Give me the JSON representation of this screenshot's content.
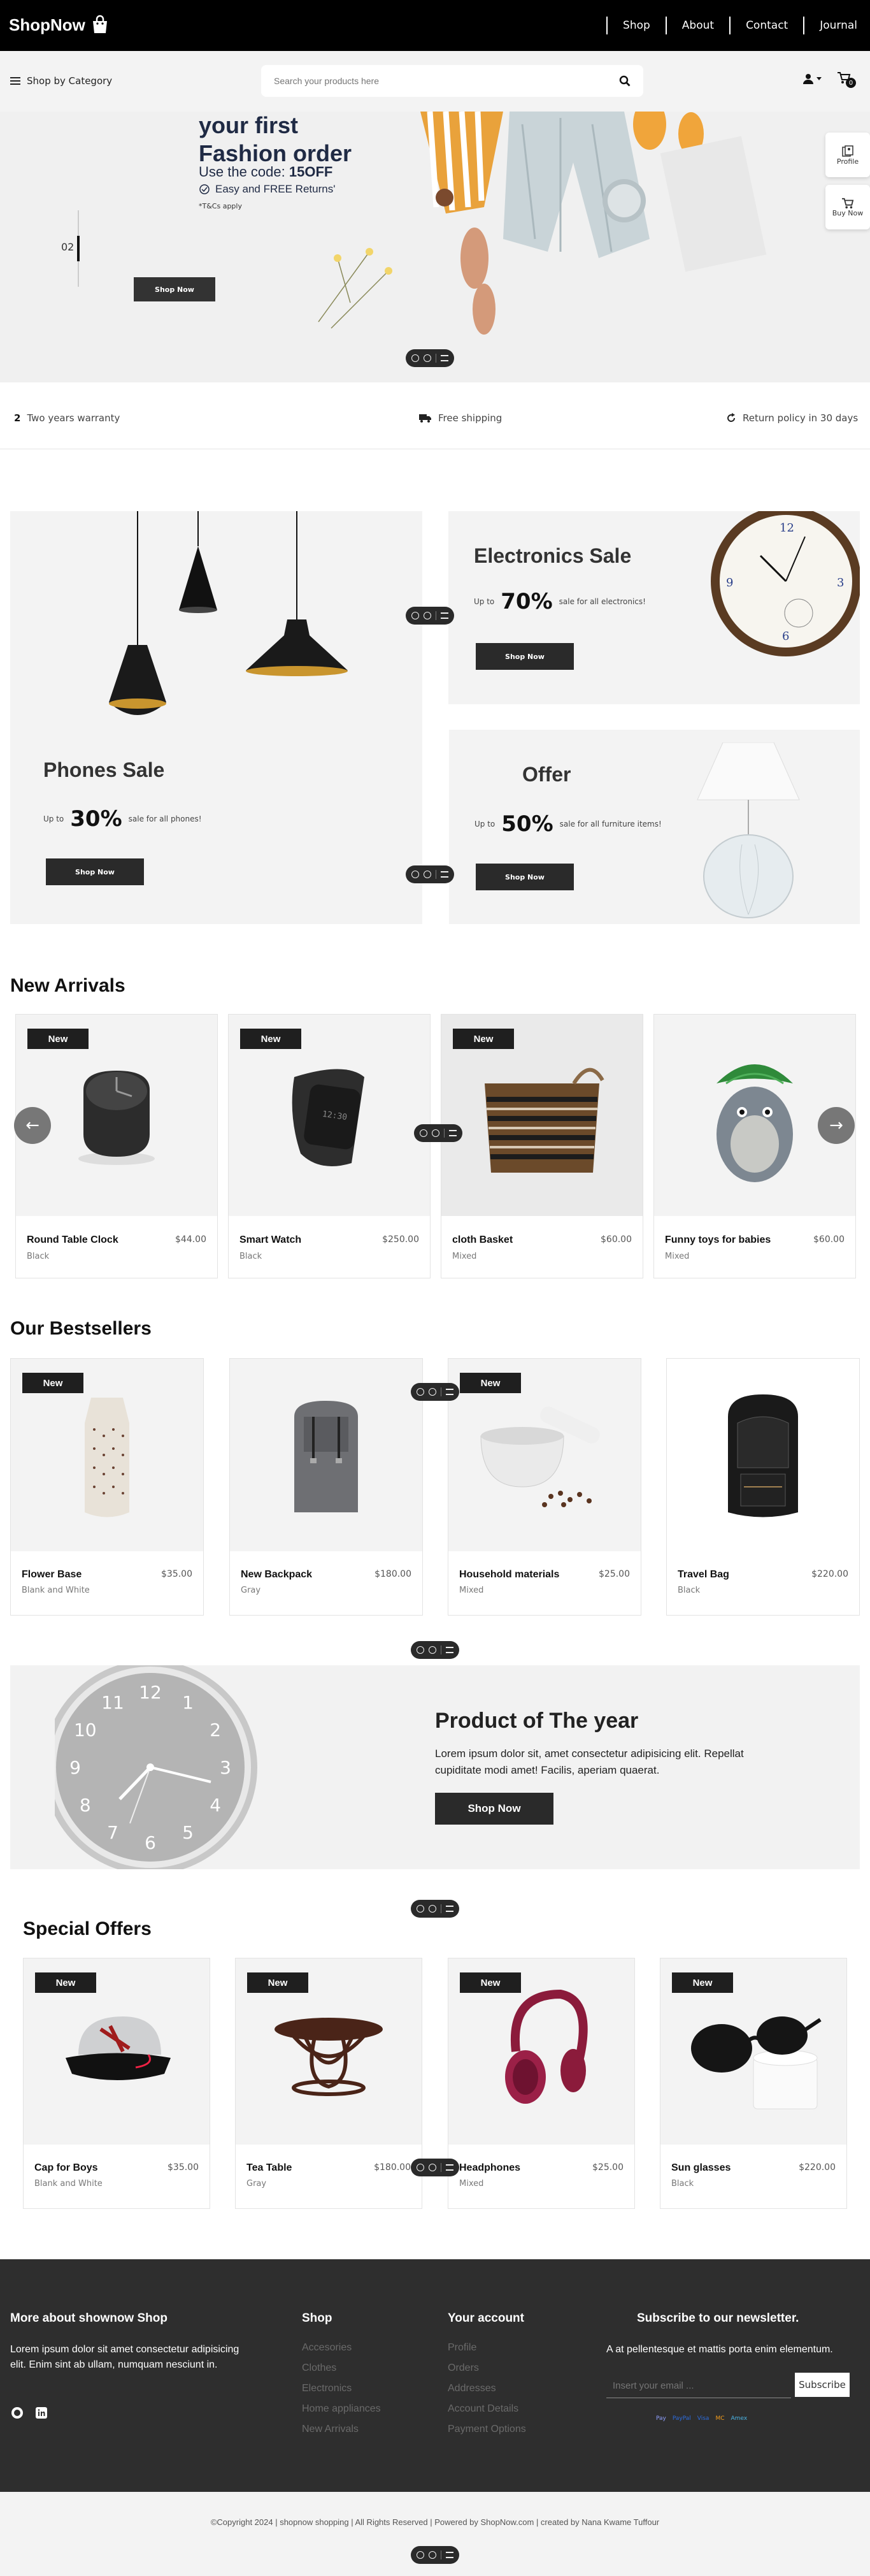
{
  "brand": {
    "name": "ShopNow"
  },
  "nav": {
    "items": [
      "Shop",
      "About",
      "Contact",
      "Journal"
    ]
  },
  "subbar": {
    "category_label": "Shop by Category",
    "search_placeholder": "Search your products here",
    "cart_count": "0"
  },
  "hero": {
    "title_line1": "your first",
    "title_line2": "Fashion order",
    "code_prefix": "Use the code: ",
    "code": "15OFF",
    "returns": "Easy and FREE Returns'",
    "tcs": "*T&Cs apply",
    "slide_number": "02",
    "button": "Shop Now"
  },
  "side_buttons": {
    "profile": "Profile",
    "buy_now": "Buy Now"
  },
  "features": {
    "warranty_num": "2",
    "warranty": "Two years warranty",
    "shipping": "Free shipping",
    "return_policy": "Return policy in 30 days"
  },
  "promos": {
    "phones": {
      "title": "Phones Sale",
      "upto": "Up to",
      "percent": "30%",
      "desc": "sale for all phones!",
      "button": "Shop Now"
    },
    "electronics": {
      "title": "Electronics Sale",
      "upto": "Up to",
      "percent": "70%",
      "desc": "sale for all electronics!",
      "button": "Shop Now"
    },
    "offer": {
      "title": "Offer",
      "upto": "Up to",
      "percent": "50%",
      "desc": "sale for all furniture items!",
      "button": "Shop Now"
    }
  },
  "new_arrivals": {
    "title": "New Arrivals",
    "badge": "New",
    "products": [
      {
        "name": "Round Table Clock",
        "price": "$44.00",
        "color": "Black"
      },
      {
        "name": "Smart Watch",
        "price": "$250.00",
        "color": "Black"
      },
      {
        "name": "cloth Basket",
        "price": "$60.00",
        "color": "Mixed"
      },
      {
        "name": "Funny toys for babies",
        "price": "$60.00",
        "color": "Mixed"
      }
    ],
    "prev_arrow": "←",
    "next_arrow": "→"
  },
  "bestsellers": {
    "title": "Our Bestsellers",
    "badge": "New",
    "products": [
      {
        "name": "Flower Base",
        "price": "$35.00",
        "color": "Blank and White"
      },
      {
        "name": "New Backpack",
        "price": "$180.00",
        "color": "Gray"
      },
      {
        "name": "Household materials",
        "price": "$25.00",
        "color": "Mixed"
      },
      {
        "name": "Travel Bag",
        "price": "$220.00",
        "color": "Black"
      }
    ]
  },
  "product_of_year": {
    "title": "Product of The year",
    "text": "Lorem ipsum dolor sit, amet consectetur adipisicing elit. Repellat cupiditate modi amet! Facilis, aperiam quaerat.",
    "button": "Shop Now",
    "clock_numbers": [
      "12",
      "1",
      "2",
      "3",
      "4",
      "5",
      "6",
      "7",
      "8",
      "9",
      "10",
      "11"
    ]
  },
  "special_offers": {
    "title": "Special Offers",
    "badge": "New",
    "products": [
      {
        "name": "Cap for Boys",
        "price": "$35.00",
        "color": "Blank and White"
      },
      {
        "name": "Tea Table",
        "price": "$180.00",
        "color": "Gray"
      },
      {
        "name": "Headphones",
        "price": "$25.00",
        "color": "Mixed"
      },
      {
        "name": "Sun glasses",
        "price": "$220.00",
        "color": "Black"
      }
    ]
  },
  "footer": {
    "about_title": "More about shownow Shop",
    "about_text": "Lorem ipsum dolor sit amet consectetur adipisicing elit. Enim sint ab ullam, numquam nesciunt in.",
    "shop_title": "Shop",
    "shop_links": [
      "Accesories",
      "Clothes",
      "Electronics",
      "Home appliances",
      "New Arrivals"
    ],
    "account_title": "Your account",
    "account_links": [
      "Profile",
      "Orders",
      "Addresses",
      "Account Details",
      "Payment Options"
    ],
    "newsletter_title": "Subscribe to our newsletter.",
    "newsletter_text": "A at pellentesque et mattis porta enim elementum.",
    "email_placeholder": "Insert your email ...",
    "subscribe": "Subscribe",
    "payments": [
      "Pay",
      "PayPal",
      "Visa",
      "MC",
      "Amex"
    ]
  },
  "copyright": "©Copyright 2024 | shopnow shopping | All Rights Reserved | Powered by ShopNow.com | created by Nana Kwame Tuffour",
  "colors": {
    "dark": "#1f1f1f",
    "footer": "#2e2e2e",
    "tile": "#f3f3f3",
    "title_blue": "#1f2a44"
  }
}
